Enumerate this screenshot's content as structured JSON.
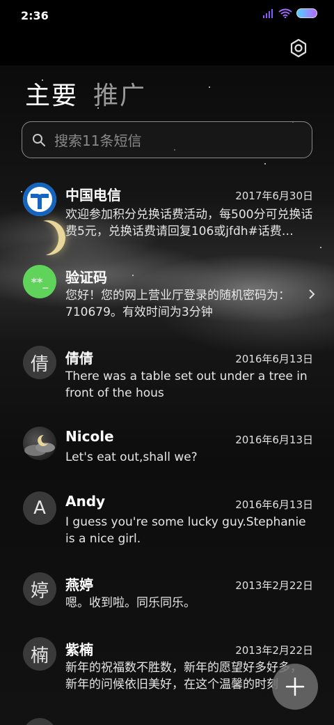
{
  "status_bar": {
    "time": "2:36"
  },
  "tabs": [
    {
      "label": "主要"
    },
    {
      "label": "推广"
    }
  ],
  "search": {
    "placeholder": "搜索11条短信"
  },
  "messages": [
    {
      "name": "中国电信",
      "date": "2017年6月30日",
      "preview": "欢迎参加积分兑换话费活动，每500分可兑换话费5元，兑换话费请回复106或jfdh#话费…",
      "avatar": "telecom-logo"
    },
    {
      "name": "验证码",
      "date": "",
      "preview": "您好！您的网上营业厅登录的随机密码为：710679。有效时间为3分钟",
      "avatar_text": "**_"
    },
    {
      "name": "倩倩",
      "date": "2016年6月13日",
      "preview": "There was a table set out under a tree in front of the hous",
      "avatar_text": "倩"
    },
    {
      "name": "Nicole",
      "date": "2016年6月13日",
      "preview": "Let's eat out,shall we?",
      "avatar": "night-sky-photo"
    },
    {
      "name": "Andy",
      "date": "2016年6月13日",
      "preview": "I guess you're some lucky guy.Stephanie is a nice girl.",
      "avatar_text": "A"
    },
    {
      "name": "燕婷",
      "date": "2013年2月22日",
      "preview": "嗯。收到啦。同乐同乐。",
      "avatar_text": "婷"
    },
    {
      "name": "紫楠",
      "date": "2013年2月22日",
      "preview": "新年的祝福数不胜数，新年的愿望好多好多，新年的问候依旧美好，在这个温馨的时刻",
      "avatar_text": "楠"
    }
  ],
  "colors": {
    "verify_green": "#5fd35a",
    "telecom_blue": "#1565c0"
  },
  "icons": {
    "settings": "gear-icon",
    "search": "search-icon",
    "fab": "plus-icon",
    "chevron": "chevron-right-icon"
  }
}
